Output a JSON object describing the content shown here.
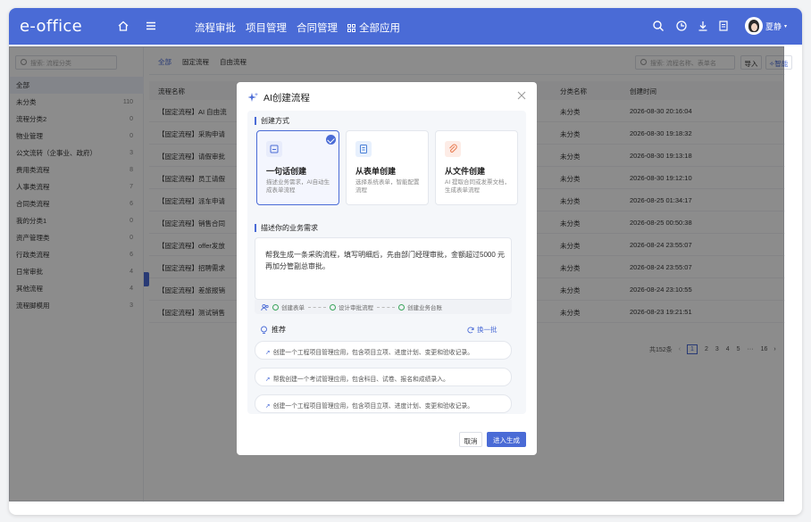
{
  "app": {
    "logo": "e-office",
    "nav": [
      "流程审批",
      "项目管理",
      "合同管理"
    ],
    "all_apps": "全部应用",
    "user_name": "夏静"
  },
  "sidebar": {
    "search_placeholder": "搜索: 流程分类",
    "items": [
      {
        "label": "全部",
        "count": ""
      },
      {
        "label": "未分类",
        "count": "110"
      },
      {
        "label": "流程分类2",
        "count": "0"
      },
      {
        "label": "物业管理",
        "count": "0"
      },
      {
        "label": "公文流转（企事业、政府）",
        "count": "3"
      },
      {
        "label": "费用类流程",
        "count": "8"
      },
      {
        "label": "人事类流程",
        "count": "7"
      },
      {
        "label": "合同类流程",
        "count": "6"
      },
      {
        "label": "我的分类1",
        "count": "0"
      },
      {
        "label": "资产管理类",
        "count": "0"
      },
      {
        "label": "行政类流程",
        "count": "6"
      },
      {
        "label": "日常审批",
        "count": "4"
      },
      {
        "label": "其他流程",
        "count": "4"
      },
      {
        "label": "流程脚模用",
        "count": "3"
      }
    ]
  },
  "main": {
    "tabs": [
      "全部",
      "固定流程",
      "自由流程"
    ],
    "search_placeholder": "搜索: 流程名称、表单名",
    "import_label": "导入",
    "smart_label": "智能",
    "headers": {
      "name": "流程名称",
      "category": "分类名称",
      "created": "创建时间"
    },
    "rows": [
      {
        "name": "【固定流程】AI 自由流",
        "category": "未分类",
        "created": "2026-08-30 20:16:04"
      },
      {
        "name": "【固定流程】采购申请",
        "category": "未分类",
        "created": "2026-08-30 19:18:32"
      },
      {
        "name": "【固定流程】请假审批",
        "category": "未分类",
        "created": "2026-08-30 19:13:18"
      },
      {
        "name": "【固定流程】员工请假",
        "category": "未分类",
        "created": "2026-08-30 19:12:10"
      },
      {
        "name": "【固定流程】派车申请",
        "category": "未分类",
        "created": "2026-08-25 01:34:17"
      },
      {
        "name": "【固定流程】销售合同",
        "category": "未分类",
        "created": "2026-08-25 00:50:38"
      },
      {
        "name": "【固定流程】offer发放",
        "category": "未分类",
        "created": "2026-08-24 23:55:07"
      },
      {
        "name": "【固定流程】招聘需求",
        "category": "未分类",
        "created": "2026-08-24 23:55:07"
      },
      {
        "name": "【固定流程】差旅报销",
        "category": "未分类",
        "created": "2026-08-24 23:10:55"
      },
      {
        "name": "【固定流程】测试销售",
        "category": "未分类",
        "created": "2026-08-23 19:21:51"
      }
    ],
    "pager": {
      "total": "共152条",
      "pages": [
        "1",
        "2",
        "3",
        "4",
        "5",
        "···",
        "16"
      ],
      "current": "1"
    }
  },
  "modal": {
    "title": "AI创建流程",
    "section_method": "创建方式",
    "cards": [
      {
        "title": "一句话创建",
        "desc": "描述业务需求，AI自动生成表单流程",
        "selected": true,
        "icon": "sparkle-doc-icon"
      },
      {
        "title": "从表单创建",
        "desc": "选择系统表单，智能配置流程",
        "selected": false,
        "icon": "form-icon"
      },
      {
        "title": "从文件创建",
        "desc": "AI 提取合同或发票文档，生成表单流程",
        "selected": false,
        "icon": "attachment-icon"
      }
    ],
    "section_desc": "描述你的业务需求",
    "description": "帮我生成一条采购流程，填写明细后，先由部门经理审批，金额超过5000 元再加分管副总审批。",
    "steps": [
      "创建表单",
      "设计审批流程",
      "创建业务台账"
    ],
    "recommend_label": "推荐",
    "refresh_label": "换一批",
    "recommendations": [
      "创建一个工程项目管理应用，包含项目立项、进度计划、变更和验收记录。",
      "帮我创建一个考试管理应用，包含科目、试卷、报名和成绩录入。",
      "创建一个工程项目管理应用，包含项目立项、进度计划、变更和验收记录。"
    ],
    "cancel_label": "取消",
    "submit_label": "进入生成"
  },
  "colors": {
    "brand": "#4a6bd6",
    "success": "#3aa55b"
  }
}
